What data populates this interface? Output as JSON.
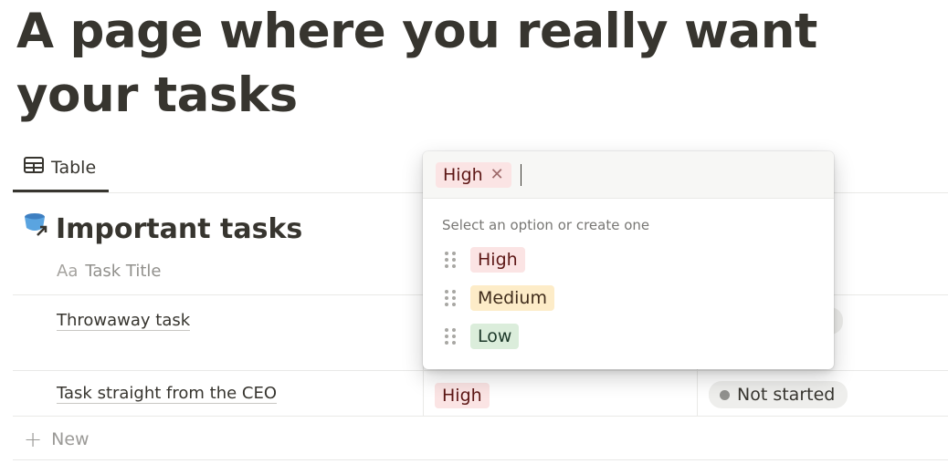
{
  "page": {
    "title": "A page where you really want your tasks"
  },
  "view_tab": {
    "label": "Table",
    "icon": "table-icon"
  },
  "database": {
    "title": "Important tasks",
    "icon": "linked-database-icon",
    "columns": [
      {
        "label": "Task Title",
        "icon": "text-property-icon",
        "icon_text": "Aa"
      }
    ],
    "rows": [
      {
        "title": "Throwaway task"
      },
      {
        "title": "Task straight from the CEO",
        "priority": "High",
        "status": "Not started"
      }
    ],
    "new_label": "New"
  },
  "select_popup": {
    "selected": "High",
    "hint": "Select an option or create one",
    "options": [
      {
        "label": "High",
        "color": "#fbe4e4"
      },
      {
        "label": "Medium",
        "color": "#fdecc8"
      },
      {
        "label": "Low",
        "color": "#dbeddb"
      }
    ]
  },
  "colors": {
    "text": "#37352f",
    "status_bg": "#eeeeec",
    "status_dot": "#91918e"
  }
}
